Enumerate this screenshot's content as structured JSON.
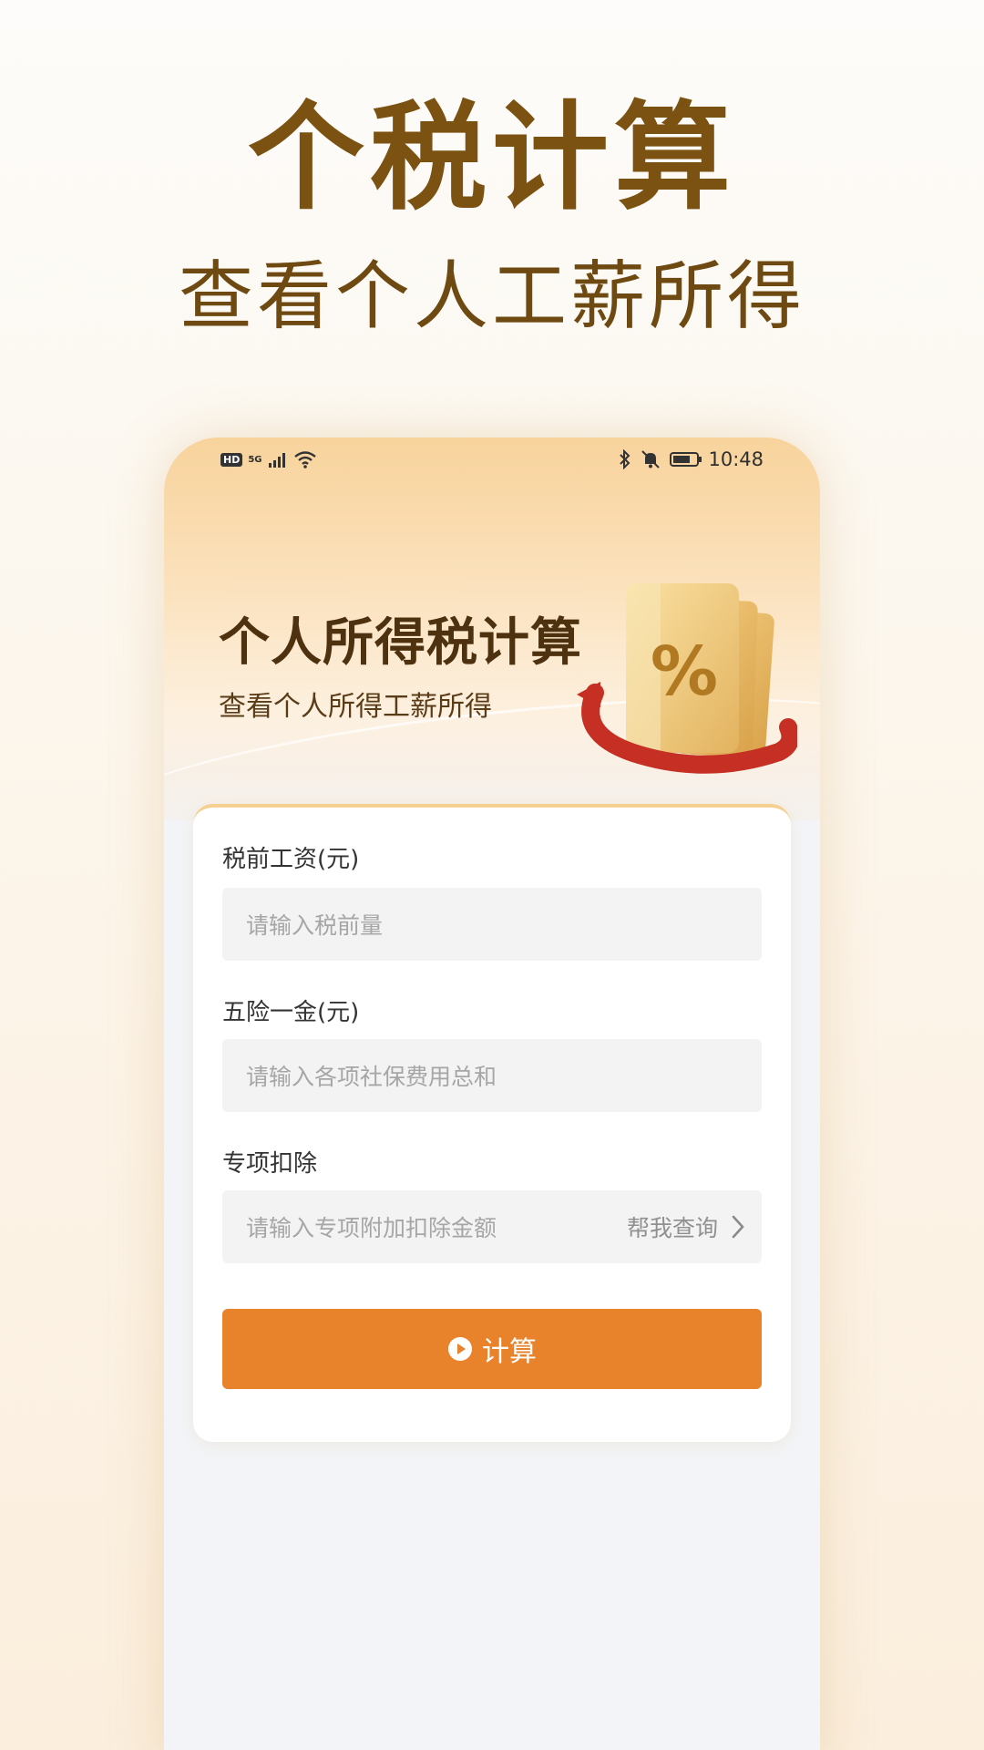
{
  "promo": {
    "title": "个税计算",
    "subtitle": "查看个人工薪所得"
  },
  "status_bar": {
    "hd": "HD",
    "network": "5G",
    "time": "10:48",
    "icons": [
      "hd-icon",
      "signal-icon",
      "wifi-icon",
      "bluetooth-icon",
      "mute-icon",
      "battery-icon"
    ]
  },
  "banner": {
    "title": "个人所得税计算",
    "subtitle": "查看个人所得工薪所得",
    "illustration_symbol": "%"
  },
  "form": {
    "salary": {
      "label": "税前工资(元)",
      "placeholder": "请输入税前量",
      "value": ""
    },
    "insurance": {
      "label": "五险一金(元)",
      "placeholder": "请输入各项社保费用总和",
      "value": ""
    },
    "deduction": {
      "label": "专项扣除",
      "placeholder": "请输入专项附加扣除金额",
      "value": "",
      "help_label": "帮我查询"
    },
    "submit_label": "计算"
  },
  "colors": {
    "accent": "#e8832c",
    "title_brown": "#7b5212",
    "banner_gold": "#f8d39c"
  }
}
